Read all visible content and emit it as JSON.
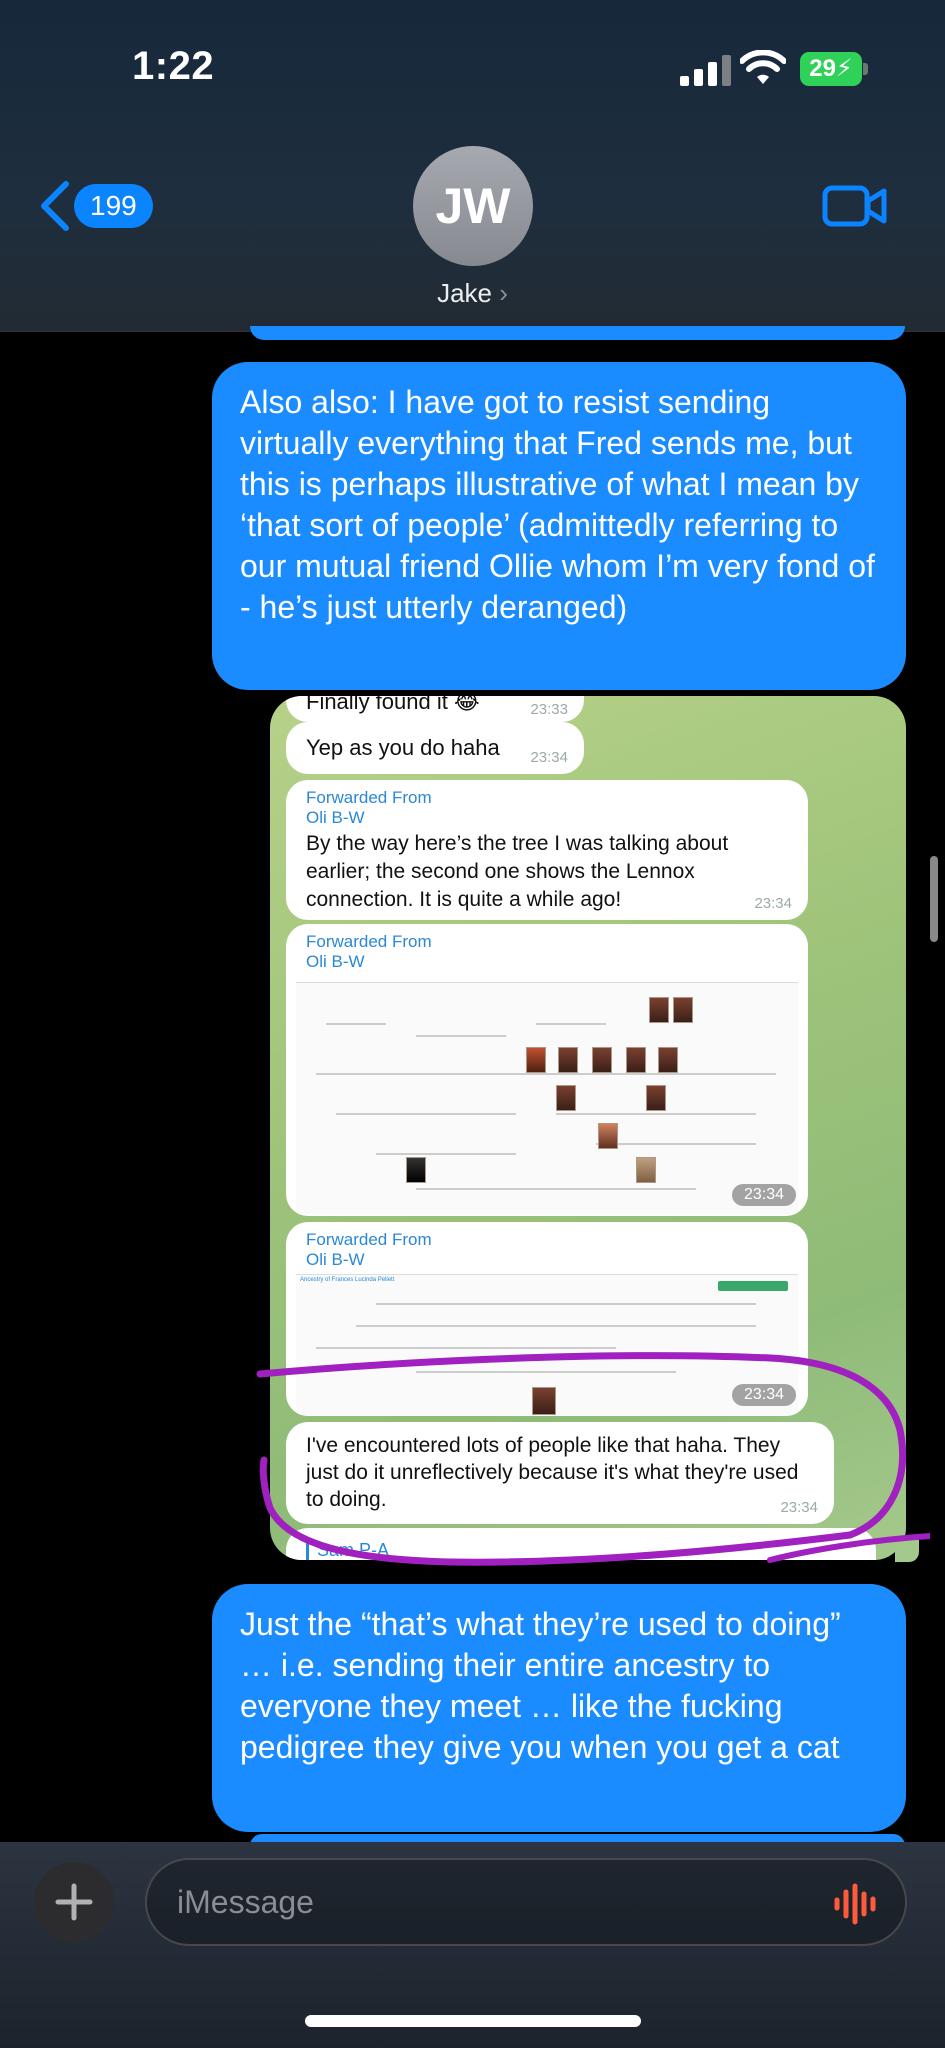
{
  "status": {
    "time": "1:22",
    "battery": "29"
  },
  "header": {
    "back_count": "199",
    "avatar_initials": "JW",
    "contact_name": "Jake",
    "chevron": "›"
  },
  "messages": [
    {
      "text": "Also also: I have got to resist sending virtually everything that Fred sends me, but this is perhaps illustrative of what I mean by ‘that sort of people’ (admittedly referring to our mutual friend Ollie whom I’m very fond of - he’s just utterly deranged)"
    },
    {
      "text": "Just the “that’s what they’re used to doing” … i.e. sending their entire ancestry to everyone they meet … like the fucking pedigree they give you when you get a cat"
    }
  ],
  "screenshot": {
    "top_partial": {
      "text": "Finally found it 😂",
      "time": "23:33"
    },
    "m1": {
      "text": "Yep as you do haha",
      "time": "23:34"
    },
    "m2": {
      "fwd_label": "Forwarded From",
      "fwd_name": "Oli B-W",
      "text": "By the way here’s the tree I was talking about earlier; the second one shows the Lennox connection. It is quite a while ago!",
      "time": "23:34"
    },
    "m3": {
      "fwd_label": "Forwarded From",
      "fwd_name": "Oli B-W",
      "time": "23:34"
    },
    "m4": {
      "fwd_label": "Forwarded From",
      "fwd_name": "Oli B-W",
      "title": "Ancestry of Frances Lucinda Pellett",
      "time": "23:34"
    },
    "m5": {
      "text": "I've encountered lots of people like that haha. They just do it unreflectively because it's what they're used to doing.",
      "time": "23:34"
    },
    "bottom_partial": {
      "text": "Sam P-A"
    }
  },
  "input": {
    "placeholder": "iMessage"
  },
  "colors": {
    "accent": "#0a84ff",
    "bubble": "#1a8cff",
    "annotation": "#a020c0"
  }
}
